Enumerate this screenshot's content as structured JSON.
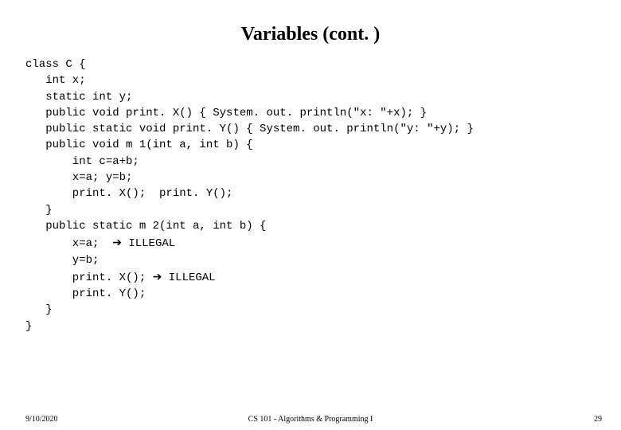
{
  "title": "Variables (cont. )",
  "code": {
    "l1": "class C {",
    "l2": "   int x;",
    "l3": "   static int y;",
    "l4": "   public void print. X() { System. out. println(\"x: \"+x); }",
    "l5": "   public static void print. Y() { System. out. println(\"y: \"+y); }",
    "l6": "   public void m 1(int a, int b) {",
    "l7": "       int c=a+b;",
    "l8": "       x=a; y=b;",
    "l9": "       print. X();  print. Y();",
    "l10": "   }",
    "l11": "   public static m 2(int a, int b) {",
    "l12a": "       x=a;  ",
    "l12b": " ILLEGAL",
    "l13": "       y=b;",
    "l14a": "       print. X(); ",
    "l14b": " ILLEGAL",
    "l15": "       print. Y();",
    "l16": "   }",
    "l17": "}"
  },
  "arrow": "➔",
  "footer": {
    "date": "9/10/2020",
    "center": "CS 101 - Algorithms & Programming I",
    "page": "29"
  }
}
